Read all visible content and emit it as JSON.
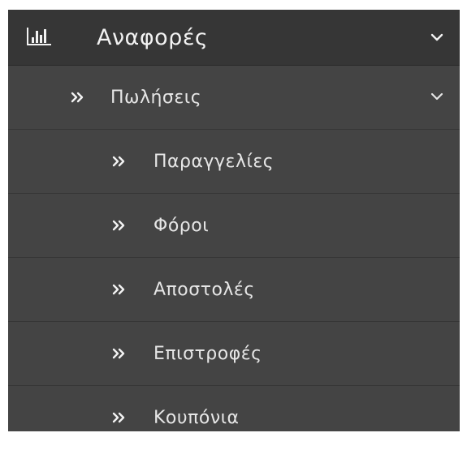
{
  "menu": {
    "title": "Αναφορές",
    "title_icon": "bar-chart-icon",
    "expand_icon": "chevron-down-icon",
    "submenu": {
      "label": "Πωλήσεις",
      "icon": "double-chevron-right-icon",
      "expand_icon": "chevron-down-icon",
      "items": [
        {
          "label": "Παραγγελίες",
          "icon": "double-chevron-right-icon"
        },
        {
          "label": "Φόροι",
          "icon": "double-chevron-right-icon"
        },
        {
          "label": "Αποστολές",
          "icon": "double-chevron-right-icon"
        },
        {
          "label": "Επιστροφές",
          "icon": "double-chevron-right-icon"
        },
        {
          "label": "Κουπόνια",
          "icon": "double-chevron-right-icon"
        }
      ]
    }
  },
  "colors": {
    "menu_background": "#444444",
    "header_background": "#363636",
    "separator": "#363636",
    "text": "#e6e6e6"
  }
}
